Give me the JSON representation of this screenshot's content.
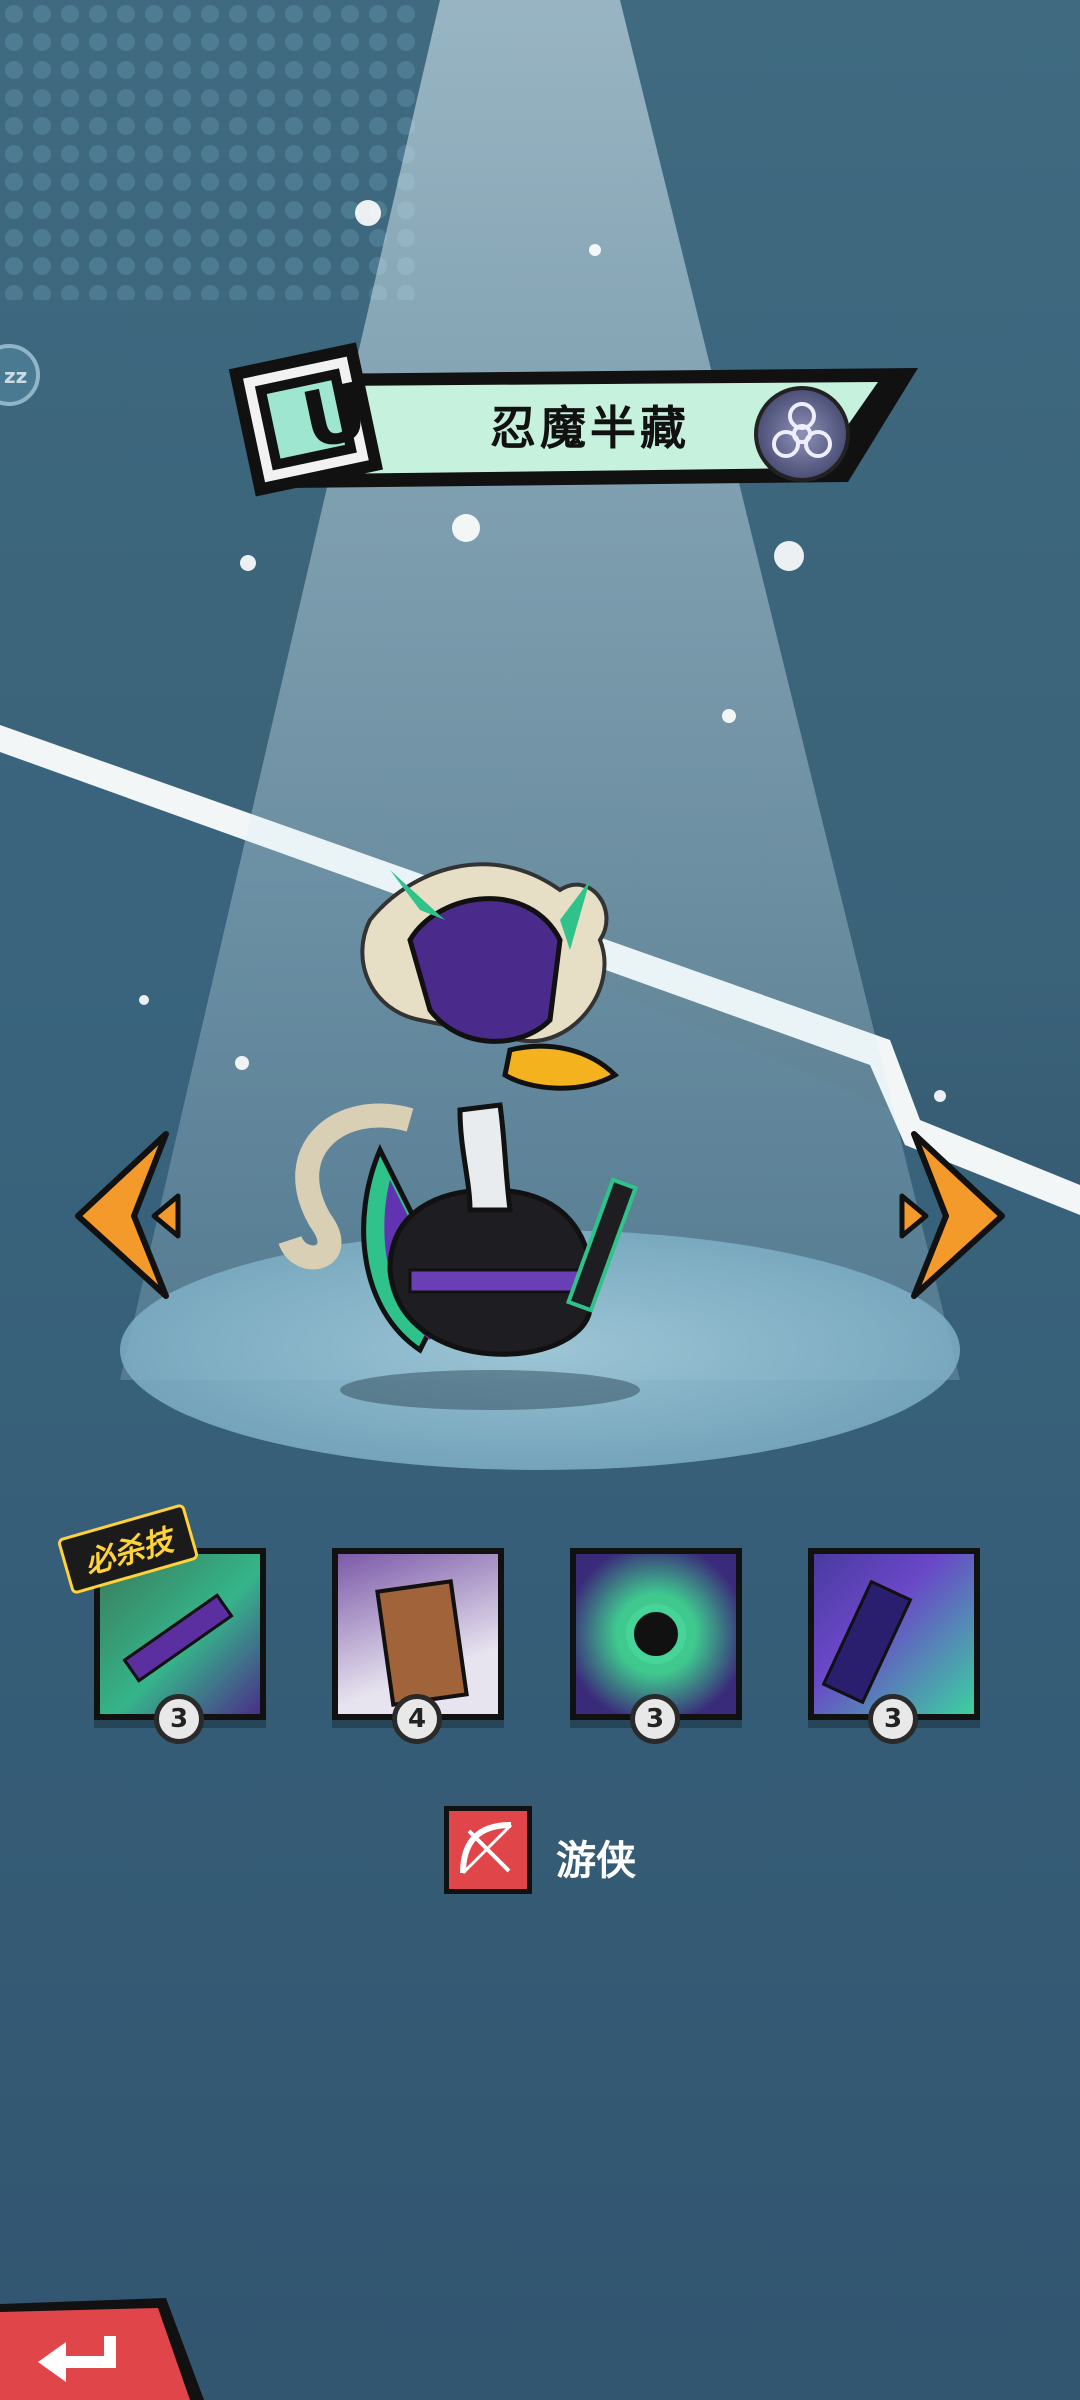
{
  "hero": {
    "rank_letter": "U",
    "name": "忍魔半藏",
    "faction_icon": "biohazard-icon"
  },
  "skills": {
    "special_tag": "必杀技",
    "items": [
      {
        "level": "3",
        "icon": "green-slash-skill-icon"
      },
      {
        "level": "4",
        "icon": "log-dummy-skill-icon"
      },
      {
        "level": "3",
        "icon": "tomoe-mark-skill-icon"
      },
      {
        "level": "3",
        "icon": "purple-blade-skill-icon"
      }
    ]
  },
  "hero_class": {
    "label": "游侠",
    "icon": "bow-icon"
  },
  "nav": {
    "prev_icon": "chevron-left-icon",
    "next_icon": "chevron-right-icon",
    "back_icon": "back-arrow-icon",
    "sleep_icon": "zz-icon"
  },
  "colors": {
    "accent_orange": "#f39a2b",
    "banner_mint": "#c6f1dd",
    "back_button_red": "#e0454a"
  }
}
